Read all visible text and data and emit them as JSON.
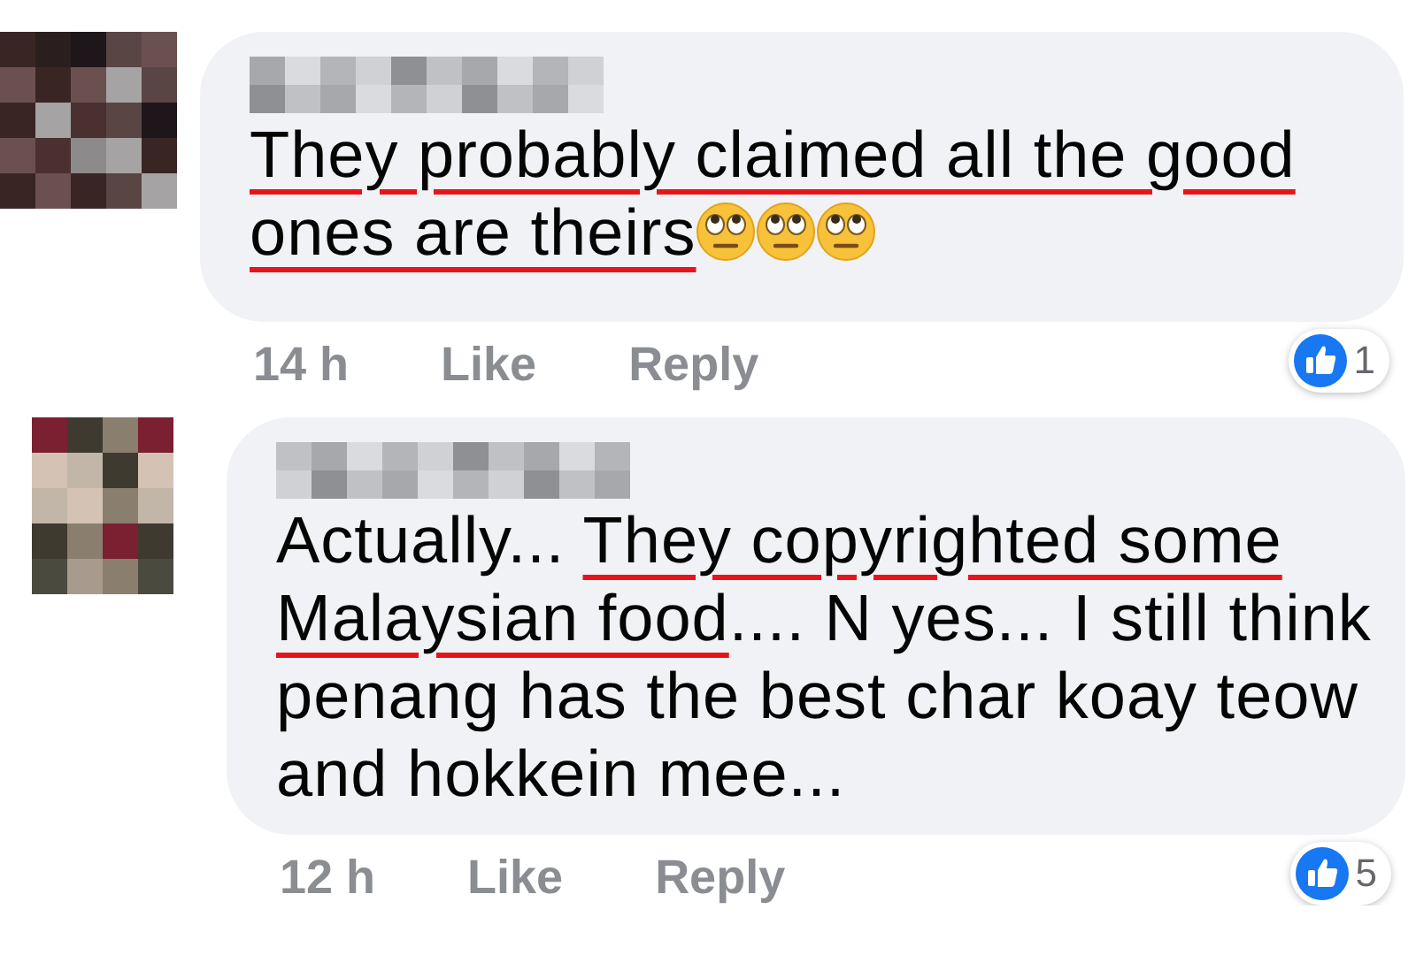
{
  "comments": [
    {
      "text": [
        {
          "text": "They probably claimed all the good ones are theirs",
          "underlined": true
        }
      ],
      "emojis": [
        {
          "kind": "eye-roll"
        },
        {
          "kind": "eye-roll"
        },
        {
          "kind": "eye-roll"
        }
      ],
      "time": "14 h",
      "actions": [
        "Like",
        "Reply"
      ],
      "reactions": "1"
    },
    {
      "text": [
        {
          "text": "Actually... ",
          "underlined": false
        },
        {
          "text": "They copyrighted some Malaysian food",
          "underlined": true
        },
        {
          "text": ".... N yes... I still think penang has the best char koay teow and hokkein mee...",
          "underlined": false
        }
      ],
      "time": "12 h",
      "actions": [
        "Like",
        "Reply"
      ],
      "reactions": "5"
    }
  ]
}
